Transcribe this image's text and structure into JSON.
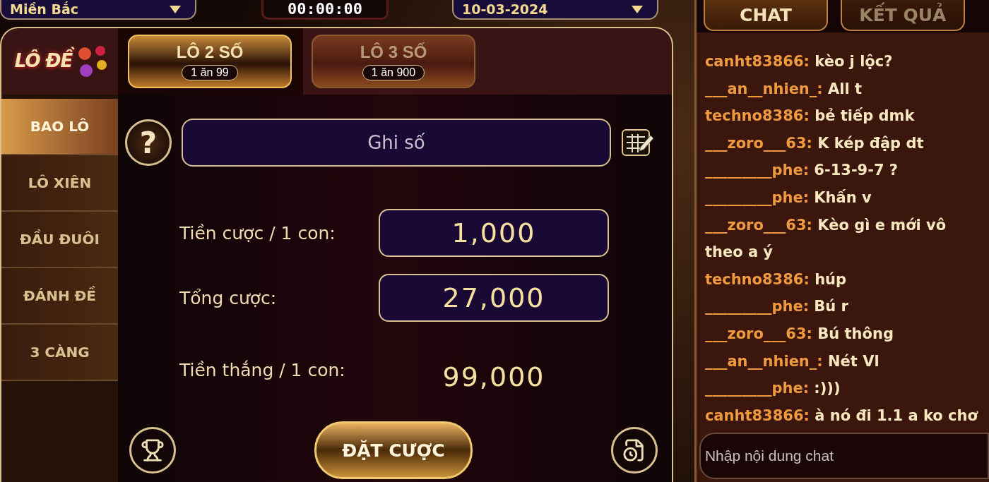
{
  "top_bar": {
    "region_select": {
      "value": "Miền Bắc"
    },
    "timer": "00:00:00",
    "date_select": {
      "value": "10-03-2024"
    }
  },
  "logo": {
    "text": "LÔ ĐỀ"
  },
  "bet_tabs": [
    {
      "label": "LÔ 2 SỐ",
      "odds": "1 ăn 99",
      "selected": true
    },
    {
      "label": "LÔ 3 SỐ",
      "odds": "1 ăn 900",
      "selected": false
    }
  ],
  "sidebar": {
    "items": [
      {
        "label": "BAO LÔ",
        "selected": true
      },
      {
        "label": "LÔ XIÊN",
        "selected": false
      },
      {
        "label": "ĐẦU ĐUÔI",
        "selected": false
      },
      {
        "label": "ĐÁNH ĐỀ",
        "selected": false
      },
      {
        "label": "3 CÀNG",
        "selected": false
      }
    ]
  },
  "help_button": "?",
  "number_field": {
    "placeholder": "Ghi số"
  },
  "fields": [
    {
      "kind": "input",
      "label": "Tiền cược / 1 con:",
      "value": "1,000"
    },
    {
      "kind": "input",
      "label": "Tổng cược:",
      "value": "27,000"
    },
    {
      "kind": "plain",
      "label": "Tiền thắng / 1 con:",
      "value": "99,000"
    }
  ],
  "place_bet_button": "ĐẶT CƯỢC",
  "chat_tabs": [
    {
      "label": "CHAT",
      "selected": true
    },
    {
      "label": "KẾT QUẢ",
      "selected": false
    }
  ],
  "chat_messages": [
    {
      "user": "canht83866:",
      "text": "kèo j lộc?"
    },
    {
      "user": "___an__nhien_:",
      "text": "All t"
    },
    {
      "user": "techno8386:",
      "text": "bẻ tiếp dmk"
    },
    {
      "user": "___zoro___63:",
      "text": "K kép đập dt"
    },
    {
      "user": "_________phe:",
      "text": "6-13-9-7 ?"
    },
    {
      "user": "_________phe:",
      "text": "Khấn v"
    },
    {
      "user": "___zoro___63:",
      "text": "Kèo gì e mới vô",
      "continuation": "theo a ý"
    },
    {
      "user": "techno8386:",
      "text": "húp"
    },
    {
      "user": "_________phe:",
      "text": "Bú r"
    },
    {
      "user": "___zoro___63:",
      "text": "Bú thông"
    },
    {
      "user": "___an__nhien_:",
      "text": "Nét Vl"
    },
    {
      "user": "_________phe:",
      "text": ":)))"
    },
    {
      "user": "canht83866:",
      "text": "à nó đi 1.1 a ko chơ"
    }
  ],
  "chat_input": {
    "placeholder": "Nhập nội dung chat"
  }
}
